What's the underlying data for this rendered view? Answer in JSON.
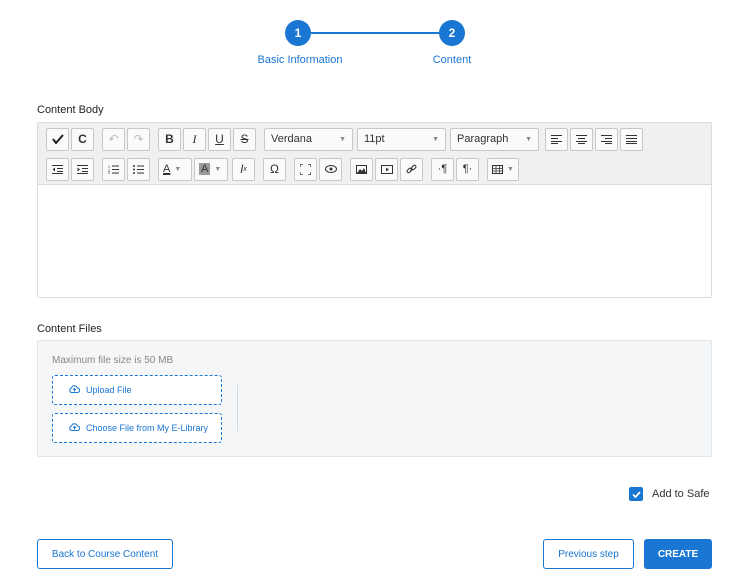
{
  "stepper": {
    "steps": [
      {
        "number": "1",
        "label": "Basic Information"
      },
      {
        "number": "2",
        "label": "Content"
      }
    ]
  },
  "content_body": {
    "label": "Content Body",
    "toolbar": {
      "font_family": "Verdana",
      "font_size": "11pt",
      "block_format": "Paragraph"
    }
  },
  "content_files": {
    "label": "Content Files",
    "hint": "Maximum file size is 50 MB",
    "upload_label": "Upload File",
    "library_label": "Choose File from My E-Library"
  },
  "add_to_safe": {
    "label": "Add to Safe",
    "checked": true
  },
  "actions": {
    "back_label": "Back to Course Content",
    "previous_label": "Previous step",
    "create_label": "CREATE"
  },
  "colors": {
    "accent": "#1976d2"
  }
}
